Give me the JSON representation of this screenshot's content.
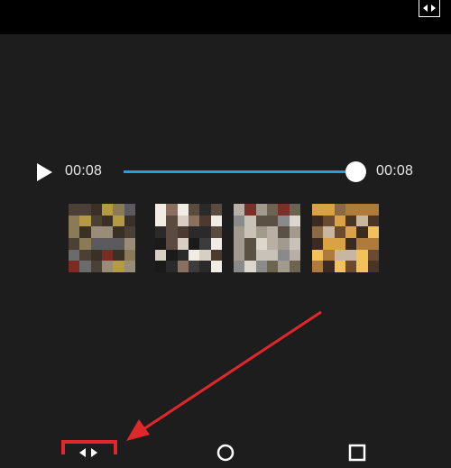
{
  "player": {
    "current_time": "00:08",
    "duration": "00:08",
    "progress_fraction": 1.0,
    "accent_color": "#2c9be3"
  },
  "icons": {
    "top_right": "split-arrows-icon",
    "play": "play-icon",
    "bottom_left": "split-arrows-icon",
    "bottom_middle": "circle-icon",
    "bottom_right": "square-icon"
  },
  "frames": [
    {
      "name": "frame-thumbnail-1"
    },
    {
      "name": "frame-thumbnail-2"
    },
    {
      "name": "frame-thumbnail-3"
    },
    {
      "name": "frame-thumbnail-4"
    }
  ],
  "annotation": {
    "highlight_color": "#e0282b"
  }
}
